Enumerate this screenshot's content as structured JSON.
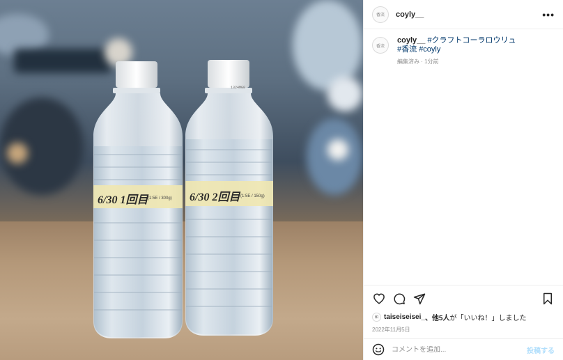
{
  "post": {
    "username": "coyly__",
    "avatar_text": "香流",
    "more_icon": "more-dots-icon"
  },
  "photo": {
    "bottle_left_label": "6/30 1回目",
    "bottle_left_small": "(1:5E / 300g)",
    "bottle_right_label": "6/30 2回目",
    "bottle_right_small": "(1:5E / 150g)",
    "cap_text": "1324MG0"
  },
  "caption": {
    "user": "coyly__",
    "tag1": "#クラフトコーラロウリュ",
    "tag2": "#香流",
    "tag3": "#coyly",
    "meta": "編集済み · 1分前"
  },
  "actions": {
    "icons": [
      "heart-icon",
      "comment-icon",
      "share-icon",
      "bookmark-icon"
    ]
  },
  "likes": {
    "avatar_text": "和",
    "user": "taiseiseisei_",
    "others": "、他5人",
    "suffix": "が「いいね！」しました"
  },
  "date": "2022年11月5日",
  "comment": {
    "placeholder": "コメントを追加...",
    "post_label": "投稿する"
  },
  "colors": {
    "hashtag": "#00376b",
    "post_button": "#b2dffc",
    "muted": "#8e8e8e"
  }
}
